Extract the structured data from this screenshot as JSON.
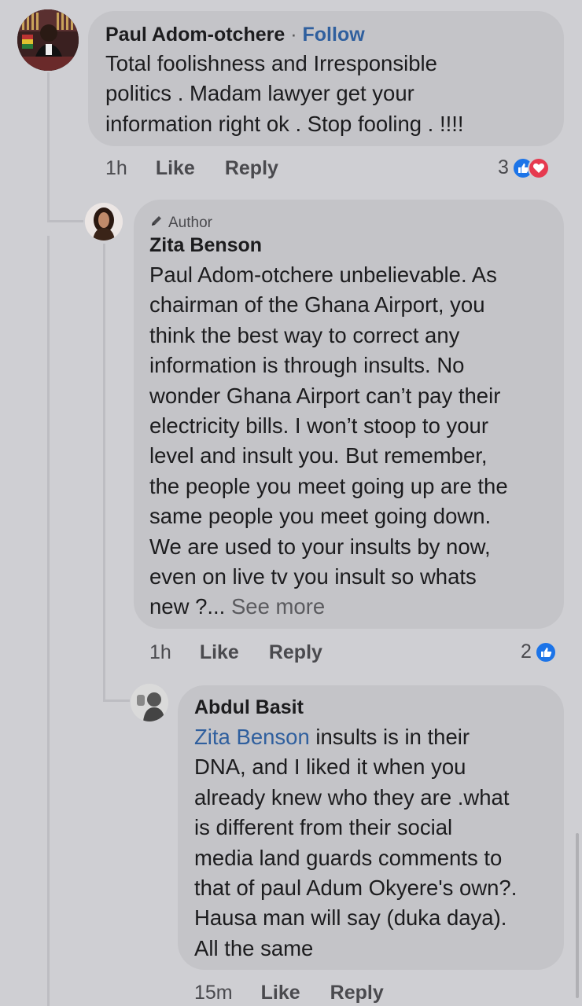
{
  "comments": [
    {
      "author": "Paul Adom-otchere",
      "follow_label": "Follow",
      "separator": "·",
      "text": "Total foolishness and Irresponsible\npolitics . Madam lawyer get your\ninformation right ok . Stop fooling . !!!!",
      "time": "1h",
      "like_label": "Like",
      "reply_label": "Reply",
      "reaction_count": "3"
    },
    {
      "badge": "Author",
      "author": "Zita Benson",
      "text": "Paul Adom-otchere unbelievable. As\nchairman of the Ghana Airport, you\nthink the best way to correct any\ninformation is through insults. No\nwonder Ghana Airport can’t pay their\nelectricity bills. I won’t stoop to your\nlevel and insult you. But remember,\nthe people you meet going up are the\nsame people you meet going down.\nWe are used to your insults by now,\neven on live tv you insult so whats\nnew ?...",
      "see_more": " See more",
      "time": "1h",
      "like_label": "Like",
      "reply_label": "Reply",
      "reaction_count": "2"
    },
    {
      "author": "Abdul Basit",
      "mention": "Zita Benson",
      "text": " insults is in their\nDNA, and I liked it when you\nalready knew who they are .what\nis different from their social\nmedia land guards comments to\nthat of paul Adum Okyere's own?.\nHausa  man will say (duka daya).\nAll the same",
      "time": "15m",
      "like_label": "Like",
      "reply_label": "Reply"
    }
  ],
  "icons": {
    "like": "like-thumb-icon",
    "love": "love-heart-icon",
    "pencil": "pencil-icon"
  },
  "colors": {
    "link": "#2f5f9e",
    "like": "#1c74e8",
    "love": "#e63a4f"
  }
}
